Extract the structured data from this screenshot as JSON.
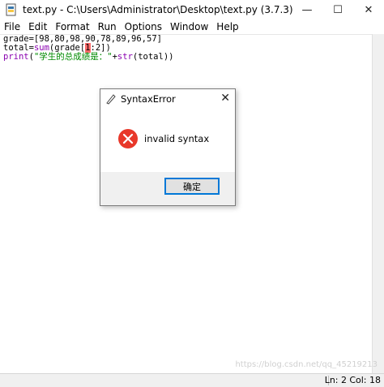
{
  "window": {
    "title": "text.py - C:\\Users\\Administrator\\Desktop\\text.py (3.7.3)",
    "minimize_glyph": "—",
    "maximize_glyph": "☐",
    "close_glyph": "✕"
  },
  "menu": {
    "items": [
      {
        "label": "File"
      },
      {
        "label": "Edit"
      },
      {
        "label": "Format"
      },
      {
        "label": "Run"
      },
      {
        "label": "Options"
      },
      {
        "label": "Window"
      },
      {
        "label": "Help"
      }
    ]
  },
  "editor": {
    "line1": "grade=[98,80,98,90,78,89,96,57]",
    "line2_pre": "total=",
    "line2_builtin": "sum",
    "line2_mid": "(grade[",
    "line2_err": "1",
    "line2_post": ":2])",
    "line3_builtin": "print",
    "line3_open": "(",
    "line3_str": "\"学生的总成绩是：\"",
    "line3_op": "+",
    "line3_builtin2": "str",
    "line3_tail": "(total))"
  },
  "dialog": {
    "title": "SyntaxError",
    "close_glyph": "✕",
    "message": "invalid syntax",
    "ok_label": "确定"
  },
  "status": {
    "line": "Ln: 2",
    "col": "Col: 18"
  },
  "watermark": "https://blog.csdn.net/qq_45219213"
}
